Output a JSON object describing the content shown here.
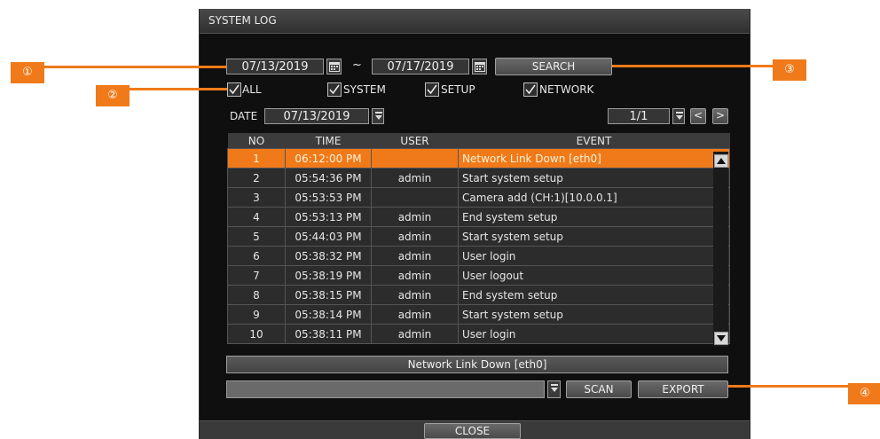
{
  "window": {
    "title": "SYSTEM LOG"
  },
  "search": {
    "start_date": "07/13/2019",
    "separator": "~",
    "end_date": "07/17/2019",
    "search_label": "SEARCH"
  },
  "filters": [
    {
      "label": "ALL",
      "checked": true
    },
    {
      "label": "SYSTEM",
      "checked": true
    },
    {
      "label": "SETUP",
      "checked": true
    },
    {
      "label": "NETWORK",
      "checked": true
    }
  ],
  "date_bar": {
    "label": "DATE",
    "value": "07/13/2019",
    "page": "1/1",
    "prev": "<",
    "next": ">"
  },
  "table": {
    "headers": [
      "NO",
      "TIME",
      "USER",
      "EVENT"
    ],
    "rows": [
      {
        "no": "1",
        "time": "06:12:00 PM",
        "user": "",
        "event": "Network Link Down [eth0]",
        "selected": true
      },
      {
        "no": "2",
        "time": "05:54:36 PM",
        "user": "admin",
        "event": "Start system setup"
      },
      {
        "no": "3",
        "time": "05:53:53 PM",
        "user": "",
        "event": "Camera add (CH:1)[10.0.0.1]"
      },
      {
        "no": "4",
        "time": "05:53:13 PM",
        "user": "admin",
        "event": "End system setup"
      },
      {
        "no": "5",
        "time": "05:44:03 PM",
        "user": "admin",
        "event": "Start system setup"
      },
      {
        "no": "6",
        "time": "05:38:32 PM",
        "user": "admin",
        "event": "User login"
      },
      {
        "no": "7",
        "time": "05:38:19 PM",
        "user": "admin",
        "event": "User logout"
      },
      {
        "no": "8",
        "time": "05:38:15 PM",
        "user": "admin",
        "event": "End system setup"
      },
      {
        "no": "9",
        "time": "05:38:14 PM",
        "user": "admin",
        "event": "Start system setup"
      },
      {
        "no": "10",
        "time": "05:38:11 PM",
        "user": "admin",
        "event": "User login"
      }
    ]
  },
  "detail": {
    "text": "Network Link Down [eth0]"
  },
  "export_bar": {
    "device_value": "",
    "scan_label": "SCAN",
    "export_label": "EXPORT"
  },
  "close_label": "CLOSE",
  "callouts": [
    "①",
    "②",
    "③",
    "④"
  ],
  "colors": {
    "accent": "#f07a1a",
    "panel": "#0f0f0f"
  }
}
